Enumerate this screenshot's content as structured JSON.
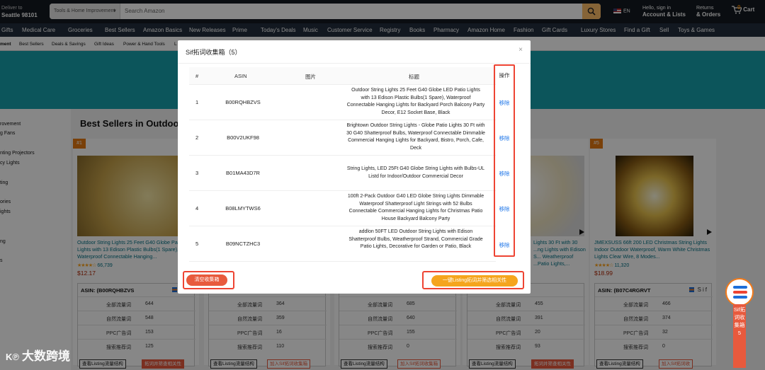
{
  "header": {
    "deliver_l1": "Deliver to",
    "deliver_l2": "Seattle 98101",
    "search_category": "Tools & Home Improvement",
    "search_placeholder": "Search Amazon",
    "lang": "EN",
    "account_l1": "Hello, sign in",
    "account_l2": "Account & Lists",
    "orders_l1": "Returns",
    "orders_l2": "& Orders",
    "cart_count": "0",
    "cart_label": "Cart"
  },
  "nav": [
    "Gifts",
    "Medical Care",
    "Groceries",
    "Best Sellers",
    "Amazon Basics",
    "New Releases",
    "Prime",
    "Today's Deals",
    "Music",
    "Customer Service",
    "Registry",
    "Books",
    "Pharmacy",
    "Amazon Home",
    "Fashion",
    "Gift Cards",
    "Luxury Stores",
    "Find a Gift",
    "Sell",
    "Toys & Games"
  ],
  "subnav": [
    "ment",
    "Best Sellers",
    "Deals & Savings",
    "Gift Ideas",
    "Power & Hand Tools",
    "L"
  ],
  "leftcol": [
    "rovement",
    "g Fans",
    "nting Projectors",
    "cy Lights",
    "ting",
    "ories",
    "ights",
    "ng",
    "s"
  ],
  "best_sellers_title": "Best Sellers in Outdoo",
  "products": [
    {
      "rank": "#1",
      "title": "Outdoor String Lights 25 Feet G40 Globe Patio Lights with 13 Edison Plastic Bulbs(1 Spare), Waterproof Connectable Hanging...",
      "reviews": "66,739",
      "price": "$12.17",
      "asin": "ASIN: (B00RQHBZVS",
      "stats": [
        {
          "k": "全部流量词",
          "v": "644"
        },
        {
          "k": "自然流量词",
          "v": "548"
        },
        {
          "k": "PPC广告词",
          "v": "153"
        },
        {
          "k": "搜索推荐词",
          "v": "125"
        }
      ],
      "btn1": "查看Listing流量结构",
      "btn2": "拓词并筛查相关性"
    },
    {
      "rank": "#2",
      "title": "",
      "reviews": "",
      "price": "",
      "asin": "",
      "stats": [
        {
          "k": "全部流量词",
          "v": "364"
        },
        {
          "k": "自然流量词",
          "v": "359"
        },
        {
          "k": "PPC广告词",
          "v": "16"
        },
        {
          "k": "搜索推荐词",
          "v": "110"
        }
      ],
      "btn1": "查看Listing流量结构",
      "btn2": "加入Sif拓词收集箱"
    },
    {
      "rank": "#3",
      "title": "",
      "reviews": "",
      "price": "",
      "asin": "",
      "stats": [
        {
          "k": "全部流量词",
          "v": "685"
        },
        {
          "k": "自然流量词",
          "v": "640"
        },
        {
          "k": "PPC广告词",
          "v": "155"
        },
        {
          "k": "搜索推荐词",
          "v": "0"
        }
      ],
      "btn1": "查看Listing流量结构",
      "btn2": "加入Sif拓词收集箱"
    },
    {
      "rank": "#4",
      "title": "Lights 30 Ft with 30 ...ng Lights with Edison S... Weatherproof ...Patio Lights,...",
      "reviews": "",
      "price": "",
      "asin": "",
      "stats": [
        {
          "k": "全部流量词",
          "v": "455"
        },
        {
          "k": "自然流量词",
          "v": "391"
        },
        {
          "k": "PPC广告词",
          "v": "20"
        },
        {
          "k": "搜索推荐词",
          "v": "93"
        }
      ],
      "btn1": "查看Listing流量结构",
      "btn2": "拓词并筛查相关性"
    },
    {
      "rank": "#5",
      "title": "JMEXSUSS 66ft 200 LED Christmas String Lights Indoor Outdoor Waterproof, Warm White Christmas Lights Clear Wire, 8 Modes...",
      "reviews": "11,320",
      "price": "$18.99",
      "asin": "ASIN: (B07C4RGRVT",
      "stats": [
        {
          "k": "全部流量词",
          "v": "466"
        },
        {
          "k": "自然流量词",
          "v": "374"
        },
        {
          "k": "PPC广告词",
          "v": "32"
        },
        {
          "k": "搜索推荐词",
          "v": "0"
        }
      ],
      "btn1": "查看Listing流量结构",
      "btn2": "加入Sif拓词收"
    }
  ],
  "modal": {
    "title": "Sif拓词收集箱（5）",
    "close": "×",
    "headers": {
      "idx": "#",
      "asin": "ASIN",
      "img": "图片",
      "title": "标题",
      "op": "操作"
    },
    "rows": [
      {
        "idx": "1",
        "asin": "B00RQHBZVS",
        "title": "Outdoor String Lights 25 Feet G40 Globe LED Patio Lights with 13 Edison Plastic Bulbs(1 Spare), Waterproof Connectable Hanging Lights for Backyard Porch Balcony Party Decor, E12 Socket Base, Black",
        "op": "移除"
      },
      {
        "idx": "2",
        "asin": "B00V2UKF98",
        "title": "Brightown Outdoor String Lights - Globe Patio Lights 30 Ft with 30 G40 Shatterproof Bulbs, Waterproof Connectable Dimmable Commercial Hanging Lights for Backyard, Bistro, Porch, Cafe, Deck",
        "op": "移除"
      },
      {
        "idx": "3",
        "asin": "B01MA43D7R",
        "title": "String Lights, LED 25Ft G40 Globe String Lights with Bulbs-UL Listd for Indoor/Outdoor Commercial Decor",
        "op": "移除"
      },
      {
        "idx": "4",
        "asin": "B08LMYTWS6",
        "title": "100ft 2-Pack Outdoor G40 LED Globe String Lights Dimmable Waterproof Shatterproof Light Strings with 52 Bulbs Connectable Commercial Hanging Lights for Christmas Patio House Backyard Balcony Party",
        "op": "移除"
      },
      {
        "idx": "5",
        "asin": "B09NCTZHC3",
        "title": "addlon 50FT LED Outdoor String Lights with Edison Shatterproof Bulbs, Weatherproof Strand, Commercial Grade Patio Lights, Decorative for Garden or Patio, Black",
        "op": "移除"
      }
    ],
    "clear_btn": "清空收集箱",
    "onekey_btn": "一键Listing拓词并筛选相关性"
  },
  "sidetab": "Sif拓词收集箱5",
  "watermark": "大数跨境"
}
